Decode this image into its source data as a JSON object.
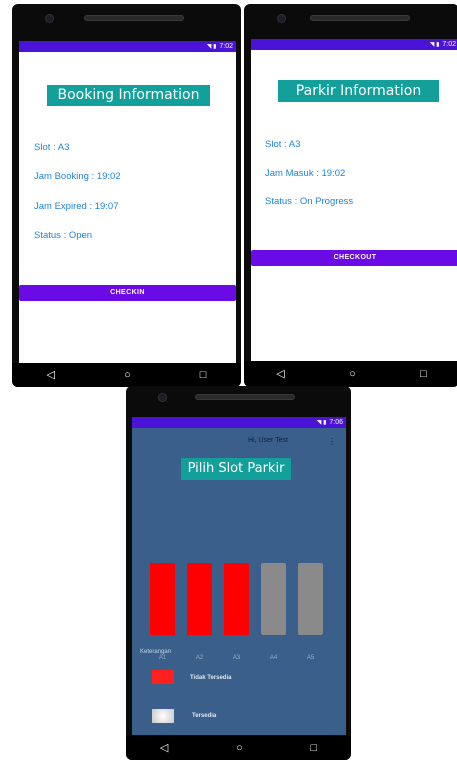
{
  "colors": {
    "status_bar": "#4b13d8",
    "button": "#6a0ae6",
    "title_bg": "#139f9a",
    "info_text": "#1e84d8",
    "parking_bg": "#3a5f8a",
    "slot_unavailable": "#ff0000",
    "slot_available": "#8a8a8a"
  },
  "booking": {
    "status_time": "7:02",
    "title": "Booking Information",
    "slot": "Slot : A3",
    "jam_booking": "Jam Booking : 19:02",
    "jam_expired": "Jam Expired : 19:07",
    "status": "Status : Open",
    "checkin_label": "CHECKIN"
  },
  "parkir": {
    "status_time": "7:02",
    "title": "Parkir Information",
    "slot": "Slot : A3",
    "jam_masuk": "Jam Masuk : 19:02",
    "status": "Status : On Progress",
    "checkout_label": "CHECKOUT"
  },
  "slots_screen": {
    "status_time": "7:06",
    "greeting": "Hi, User Test",
    "menu_icon": "⋮",
    "title": "Pilih Slot Parkir",
    "slots": [
      {
        "label": "A1",
        "available": false
      },
      {
        "label": "A2",
        "available": false
      },
      {
        "label": "A3",
        "available": false
      },
      {
        "label": "A4",
        "available": true
      },
      {
        "label": "A5",
        "available": true
      }
    ],
    "legend_title": "Keterangan",
    "legend_unavailable": "Tidak Tersedia",
    "legend_available": "Tersedia"
  },
  "nav": {
    "back": "◁",
    "home": "○",
    "recents": "□"
  },
  "status_icons": "◥ ▮"
}
